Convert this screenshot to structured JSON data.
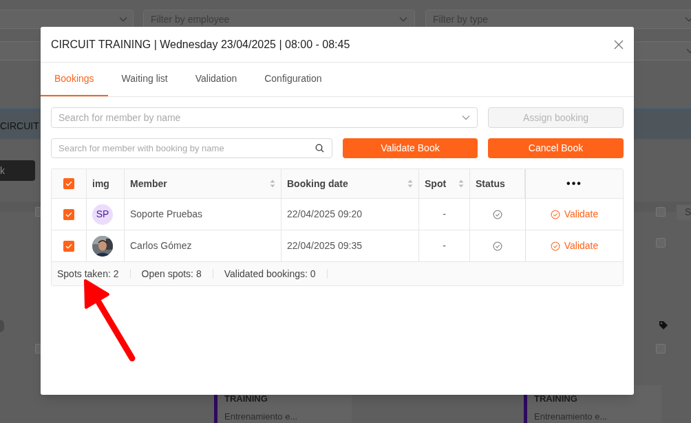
{
  "background": {
    "filters": [
      {
        "placeholder": "Filter by employee"
      },
      {
        "placeholder": "Filter by type"
      }
    ],
    "banner_text": "CIRCUIT",
    "dark_button": "k",
    "column_text": "S",
    "checkboxes": [
      {
        "checked": false
      },
      {
        "checked": false
      },
      {
        "checked": false
      },
      {
        "checked": false
      },
      {
        "checked": false
      }
    ],
    "cards": [
      {
        "title": "TRAINING",
        "subtitle": "Entrenamiento e..."
      },
      {
        "title": "TRAINING",
        "subtitle": "Entrenamiento e..."
      }
    ]
  },
  "dialog": {
    "title": "CIRCUIT TRAINING | Wednesday 23/04/2025 | 08:00 - 08:45",
    "tabs": [
      {
        "label": "Bookings",
        "selected": true
      },
      {
        "label": "Waiting list",
        "selected": false
      },
      {
        "label": "Validation",
        "selected": false
      },
      {
        "label": "Configuration",
        "selected": false
      }
    ],
    "member_select": {
      "placeholder": "Search for member by name"
    },
    "assign_button": {
      "label": "Assign booking",
      "disabled": true
    },
    "booking_search": {
      "placeholder": "Search for member with booking by name"
    },
    "buttons": [
      "Validate Book",
      "Cancel Book"
    ],
    "table": {
      "select_all": {
        "checked": true
      },
      "columns": [
        {
          "label": "img",
          "sortable": false
        },
        {
          "label": "Member",
          "sortable": true
        },
        {
          "label": "Booking date",
          "sortable": true
        },
        {
          "label": "Spot",
          "sortable": true
        },
        {
          "label": "Status",
          "sortable": false
        },
        {
          "label": "•••",
          "sortable": false
        }
      ],
      "rows": [
        {
          "checked": true,
          "avatar": {
            "kind": "initials",
            "text": "SP"
          },
          "member": "Soporte Pruebas",
          "booking_date": "22/04/2025 09:20",
          "spot": "-",
          "action": "Validate"
        },
        {
          "checked": true,
          "member": "Carlos Gómez",
          "booking_date": "22/04/2025 09:35",
          "spot": "-",
          "action": "Validate"
        }
      ],
      "footer": [
        "Spots taken: 2",
        "Open spots: 8",
        "Validated bookings: 0"
      ]
    }
  }
}
